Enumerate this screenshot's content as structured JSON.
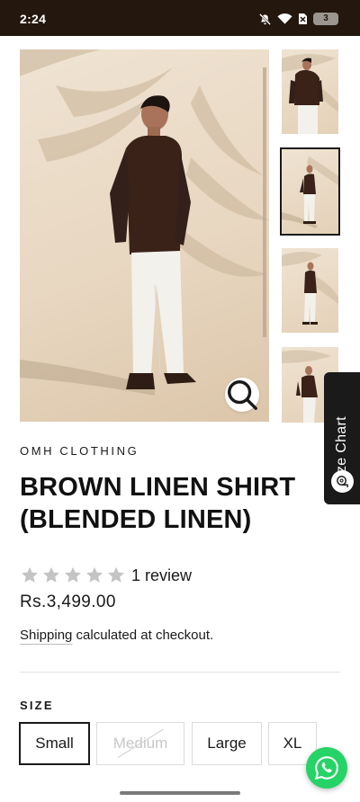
{
  "status_bar": {
    "time": "2:24",
    "battery": "3",
    "icons": [
      "mute-icon",
      "wifi-icon",
      "sim-icon"
    ]
  },
  "gallery": {
    "main_image_alt": "Model wearing brown linen shirt with white trousers",
    "thumbnails": [
      {
        "name": "thumbnail-1",
        "selected": false
      },
      {
        "name": "thumbnail-2",
        "selected": true
      },
      {
        "name": "thumbnail-3",
        "selected": false
      },
      {
        "name": "thumbnail-4",
        "selected": false
      }
    ],
    "zoom_icon": "search-icon"
  },
  "size_chart_tab": {
    "label": "Size Chart",
    "icon": "ruler-icon"
  },
  "product": {
    "brand": "OMH CLOTHING",
    "title": "BROWN LINEN SHIRT (BLENDED LINEN)",
    "rating": 5,
    "review_count": "1 review",
    "price": "Rs.3,499.00",
    "shipping_link": "Shipping",
    "shipping_text": " calculated at checkout."
  },
  "size": {
    "heading": "SIZE",
    "options": [
      {
        "label": "Small",
        "selected": true,
        "available": true
      },
      {
        "label": "Medium",
        "selected": false,
        "available": false
      },
      {
        "label": "Large",
        "selected": false,
        "available": true
      },
      {
        "label": "XL",
        "selected": false,
        "available": true
      }
    ]
  },
  "colors": {
    "status_bar_bg": "#24170e",
    "photo_bg": "#e8d7c1",
    "text": "#1a1a1a",
    "star_empty": "#c4c4c4",
    "whatsapp": "#25d366"
  },
  "floating": {
    "whatsapp_icon": "whatsapp-icon"
  }
}
